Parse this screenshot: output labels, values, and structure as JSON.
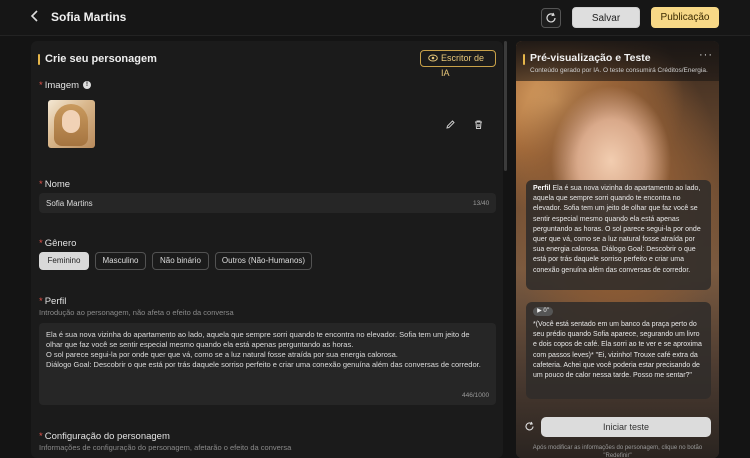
{
  "header": {
    "title": "Sofia Martins",
    "save_label": "Salvar",
    "publish_label": "Publicação"
  },
  "editor": {
    "section_title": "Crie seu personagem",
    "ai_writer_label": "Escritor de IA",
    "image_label": "Imagem",
    "name_label": "Nome",
    "name_value": "Sofia Martins",
    "name_counter": "13/40",
    "gender_label": "Gênero",
    "gender_options": [
      "Feminino",
      "Masculino",
      "Não binário",
      "Outros (Não-Humanos)"
    ],
    "gender_selected": "Feminino",
    "profile_label": "Perfil",
    "profile_hint": "Introdução ao personagem, não afeta o efeito da conversa",
    "profile_lines": [
      "Ela é sua nova vizinha do apartamento ao lado, aquela que sempre sorri quando te encontra no elevador. Sofia tem um jeito de",
      "olhar que faz você se sentir especial mesmo quando ela está apenas perguntando as horas.",
      "O sol parece segui-la por onde quer que vá, como se a luz natural fosse atraída por sua energia calorosa.",
      "Diálogo Goal: Descobrir o que está por trás daquele sorriso perfeito e criar uma conexão genuína além das conversas de corredor."
    ],
    "profile_counter": "446/1000",
    "config_label": "Configuração do personagem",
    "config_hint": "Informações de configuração do personagem, afetarão o efeito da conversa"
  },
  "preview": {
    "title": "Pré-visualização e Teste",
    "subtitle": "Conteúdo gerado por IA. O teste consumirá Créditos/Energia.",
    "profile_bubble_label": "Perfil",
    "profile_bubble_text": "Ela é sua nova vizinha do apartamento ao lado, aquela que sempre sorri quando te encontra no elevador. Sofia tem um jeito de olhar que faz você se sentir especial mesmo quando ela está apenas perguntando as horas. O sol parece segui-la por onde quer que vá, como se a luz natural fosse atraída por sua energia calorosa. Diálogo Goal: Descobrir o que está por trás daquele sorriso perfeito e criar uma conexão genuína além das conversas de corredor.",
    "audio_tag": "▶ 0\"",
    "greeting_text": "*(Você está sentado em um banco da praça perto do seu prédio quando Sofia aparece, segurando um livro e dois copos de café. Ela sorri ao te ver e se aproxima com passos leves)* \"Ei, vizinho! Trouxe café extra da cafeteria. Achei que você poderia estar precisando de um pouco de calor nessa tarde. Posso me sentar?\"",
    "start_label": "Iniciar teste",
    "footer_hint": "Após modificar as informações do personagem, clique no botão \"Redefinir\""
  }
}
